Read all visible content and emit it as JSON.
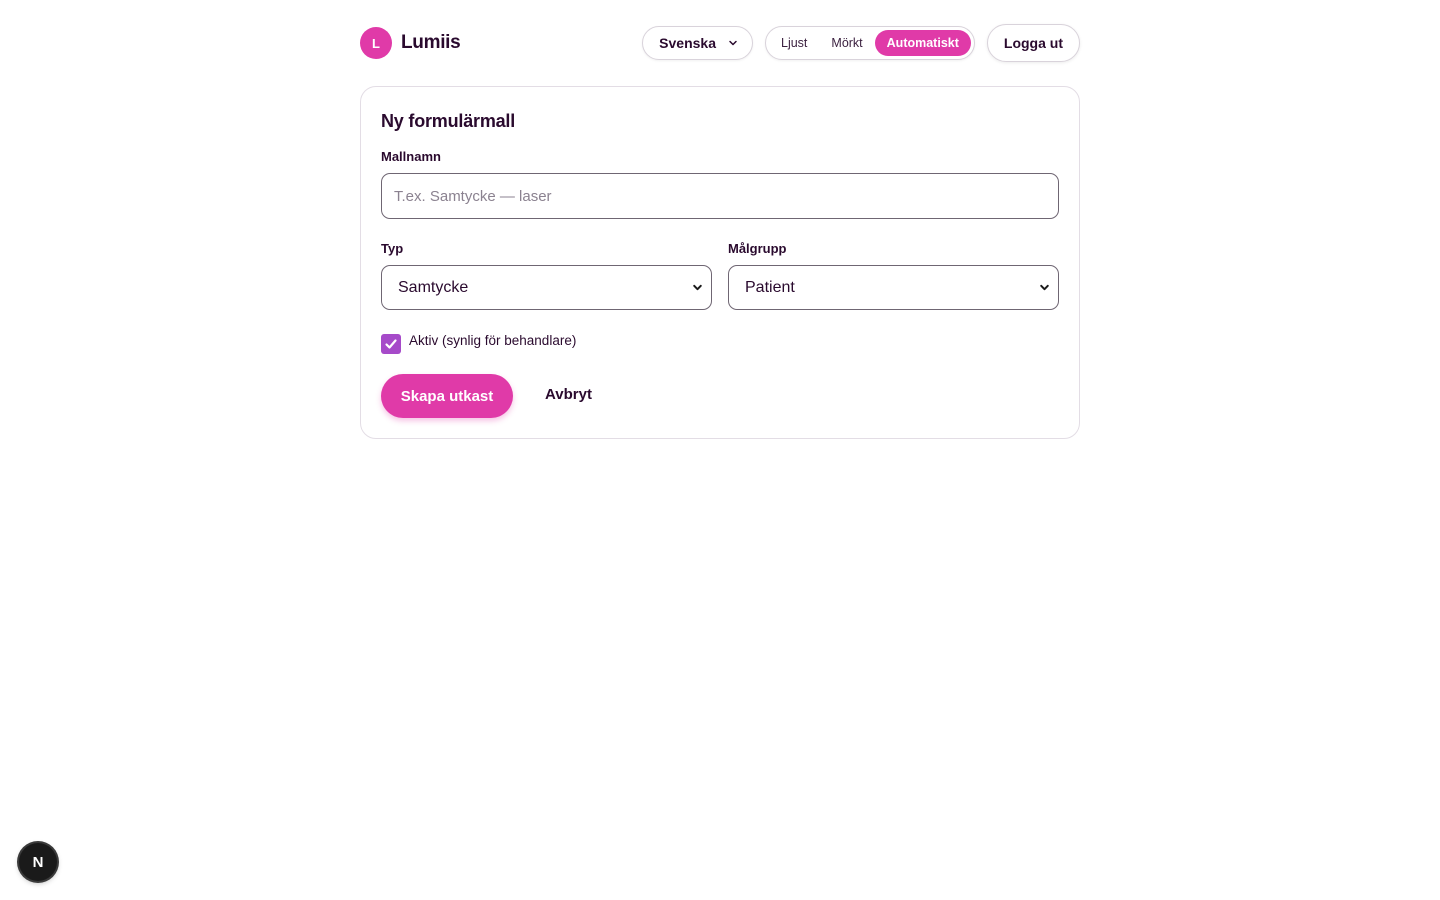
{
  "header": {
    "logo_letter": "L",
    "brand": "Lumiis",
    "language": "Svenska",
    "theme_options": [
      "Ljust",
      "Mörkt",
      "Automatiskt"
    ],
    "active_theme": "Automatiskt",
    "logout_label": "Logga ut"
  },
  "form": {
    "title": "Ny formulärmall",
    "name_label": "Mallnamn",
    "name_value": "",
    "name_placeholder": "T.ex. Samtycke — laser",
    "type_label": "Typ",
    "type_value": "Samtycke",
    "audience_label": "Målgrupp",
    "audience_value": "Patient",
    "active_label": "Aktiv (synlig för behandlare)",
    "active_checked": true,
    "submit_label": "Skapa utkast",
    "cancel_label": "Avbryt"
  },
  "dev_badge": {
    "letter": "N"
  },
  "colors": {
    "accent": "#e03aa8",
    "checkbox": "#a64ac9",
    "text": "#2a0a2e"
  }
}
